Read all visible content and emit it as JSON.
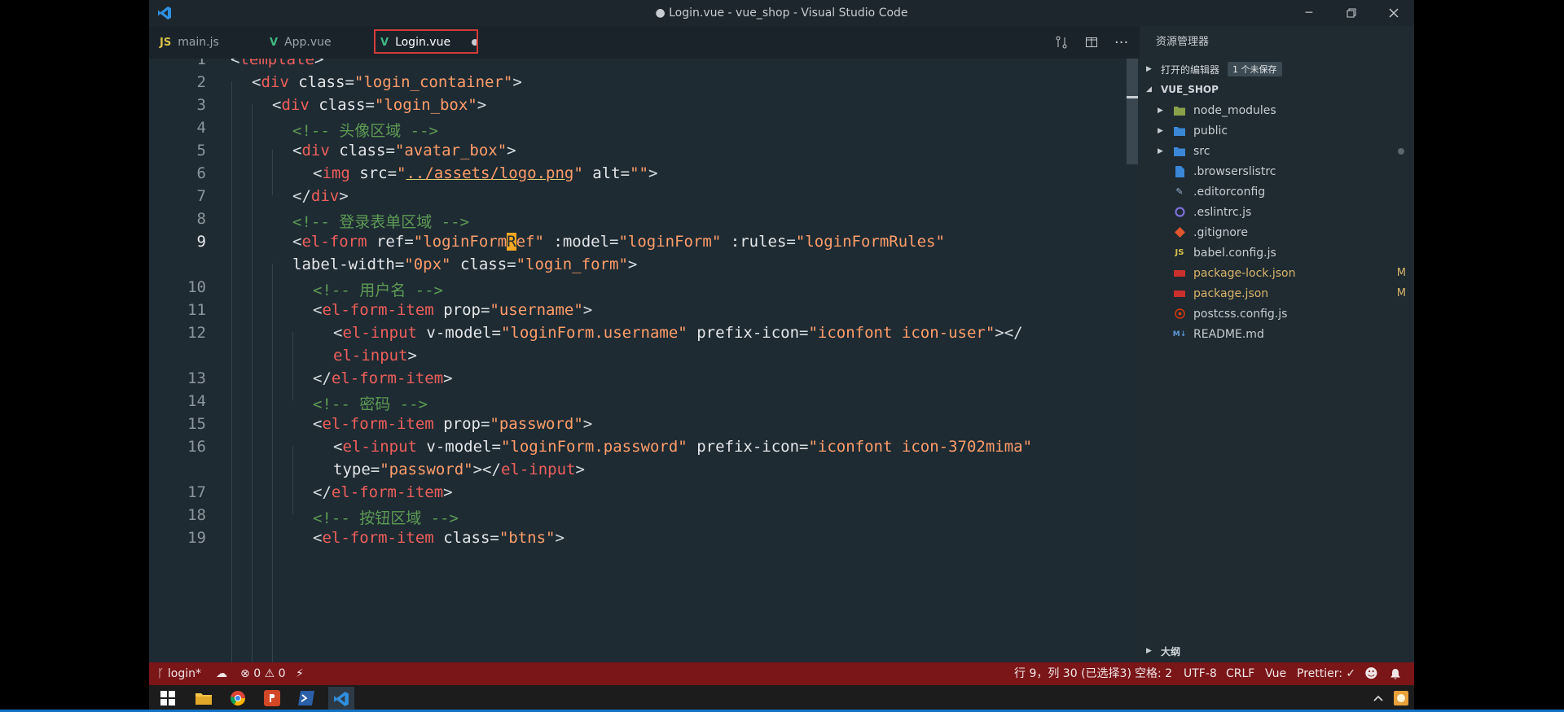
{
  "window": {
    "title": "● Login.vue - vue_shop - Visual Studio Code"
  },
  "tabs": [
    {
      "icon": "JS",
      "label": "main.js"
    },
    {
      "icon": "V",
      "label": "App.vue"
    },
    {
      "icon": "V",
      "label": "Login.vue",
      "modified": true
    }
  ],
  "editor": {
    "line_numbers": [
      "1",
      "2",
      "3",
      "4",
      "5",
      "6",
      "7",
      "8",
      "9",
      "",
      "10",
      "11",
      "12",
      "",
      "13",
      "14",
      "15",
      "16",
      "",
      "17",
      "18",
      "19"
    ]
  },
  "explorer": {
    "title": "资源管理器",
    "open_editors": {
      "label": "打开的编辑器",
      "badge": "1 个未保存"
    },
    "project": "VUE_SHOP",
    "items": [
      {
        "name": "node_modules",
        "type": "folder"
      },
      {
        "name": "public",
        "type": "folder"
      },
      {
        "name": "src",
        "type": "folder"
      },
      {
        "name": ".browserslistrc",
        "type": "file"
      },
      {
        "name": ".editorconfig",
        "type": "file"
      },
      {
        "name": ".eslintrc.js",
        "type": "file"
      },
      {
        "name": ".gitignore",
        "type": "file"
      },
      {
        "name": "babel.config.js",
        "type": "file"
      },
      {
        "name": "package-lock.json",
        "type": "file",
        "flag": "M"
      },
      {
        "name": "package.json",
        "type": "file",
        "flag": "M"
      },
      {
        "name": "postcss.config.js",
        "type": "file"
      },
      {
        "name": "README.md",
        "type": "file"
      }
    ],
    "outline": "大纲"
  },
  "statusbar": {
    "branch": "login*",
    "errors": "0",
    "warnings": "0",
    "position": "行 9，列 30 (已选择3)",
    "spaces": "空格: 2",
    "encoding": "UTF-8",
    "eol": "CRLF",
    "language": "Vue",
    "prettier": "Prettier: ✓"
  },
  "colors": {
    "statusbar": "#7a1518",
    "editor_bg": "#1e2b33",
    "tag": "#ee5f5b",
    "string": "#ff9d6a",
    "comment": "#5d9a54"
  }
}
